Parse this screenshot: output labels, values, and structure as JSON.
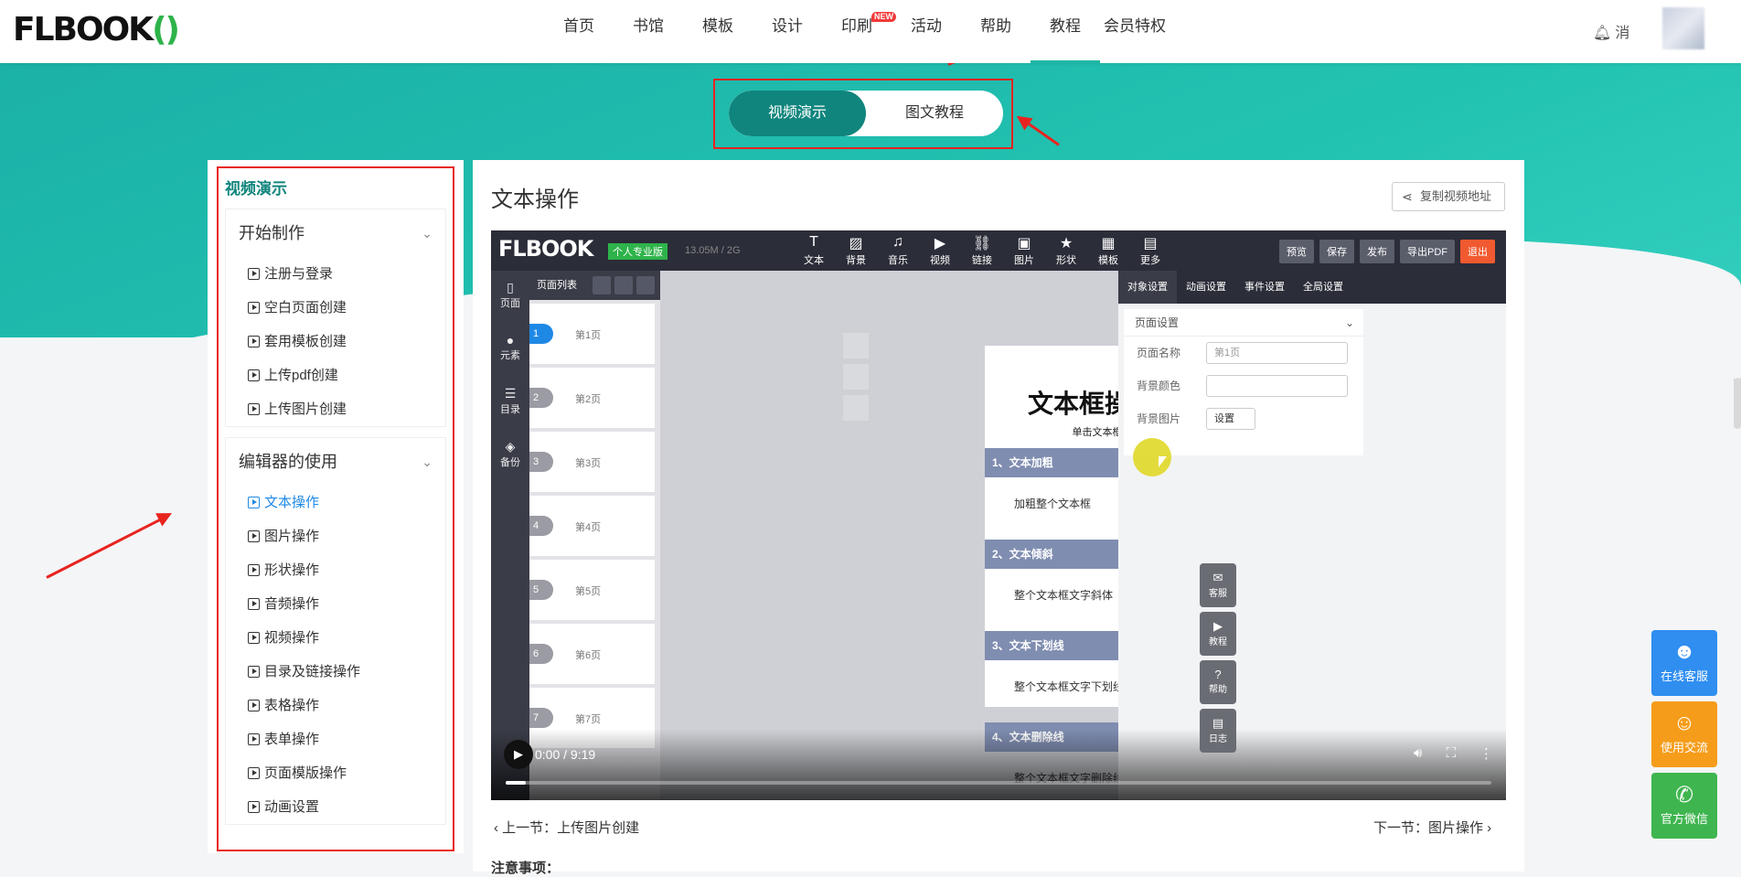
{
  "brand": {
    "logo_main": "FLBOOK",
    "logo_mark": "()"
  },
  "nav": {
    "items": [
      {
        "label": "首页"
      },
      {
        "label": "书馆"
      },
      {
        "label": "模板"
      },
      {
        "label": "设计"
      },
      {
        "label": "印刷",
        "tag": "NEW"
      },
      {
        "label": "活动"
      },
      {
        "label": "帮助"
      },
      {
        "label": "教程",
        "active": true
      },
      {
        "label": "会员特权"
      }
    ],
    "message_label": "消"
  },
  "toggle": {
    "options": [
      {
        "label": "视频演示",
        "selected": true
      },
      {
        "label": "图文教程"
      }
    ]
  },
  "sidebar": {
    "title": "视频演示",
    "groups": [
      {
        "title": "开始制作",
        "items": [
          "注册与登录",
          "空白页面创建",
          "套用模板创建",
          "上传pdf创建",
          "上传图片创建"
        ]
      },
      {
        "title": "编辑器的使用",
        "current": "文本操作",
        "items": [
          "文本操作",
          "图片操作",
          "形状操作",
          "音频操作",
          "视频操作",
          "目录及链接操作",
          "表格操作",
          "表单操作",
          "页面模版操作",
          "动画设置"
        ]
      }
    ]
  },
  "content": {
    "title": "文本操作",
    "copy_button": "复制视频地址",
    "prev": "上一节：上传图片创建",
    "next": "下一节：图片操作",
    "notes_heading": "注意事项："
  },
  "editor": {
    "logo": "FLBOOK",
    "plan_badge": "个人专业版",
    "storage": "13.05M / 2G",
    "tools": [
      {
        "icon": "T",
        "label": "文本"
      },
      {
        "icon": "▨",
        "label": "背景"
      },
      {
        "icon": "♫",
        "label": "音乐"
      },
      {
        "icon": "▶",
        "label": "视频"
      },
      {
        "icon": "⛓",
        "label": "链接"
      },
      {
        "icon": "▣",
        "label": "图片"
      },
      {
        "icon": "★",
        "label": "形状"
      },
      {
        "icon": "▦",
        "label": "模板"
      },
      {
        "icon": "▤",
        "label": "更多"
      }
    ],
    "buttons": [
      "预览",
      "保存",
      "发布",
      "导出PDF",
      "退出"
    ],
    "rail": [
      {
        "icon": "▯",
        "label": "页面"
      },
      {
        "icon": "●",
        "label": "元素"
      },
      {
        "icon": "☰",
        "label": "目录"
      },
      {
        "icon": "◈",
        "label": "备份"
      }
    ],
    "page_list_title": "页面列表",
    "pages": [
      "第1页",
      "第2页",
      "第3页",
      "第4页",
      "第5页",
      "第6页",
      "第7页"
    ],
    "card": {
      "title": "文本框操作演示",
      "subtitle": "单击文本框进行设置",
      "sections": [
        {
          "head": "1、文本加粗",
          "body": "加粗整个文本框"
        },
        {
          "head": "2、文本倾斜",
          "body": "整个文本框文字斜体"
        },
        {
          "head": "3、文本下划线",
          "body": "整个文本框文字下划线"
        },
        {
          "head": "4、文本删除线",
          "body": "整个文本框文字删除线"
        }
      ]
    },
    "right_buttons": [
      {
        "icon": "✉",
        "label": "客服"
      },
      {
        "icon": "▶",
        "label": "教程"
      },
      {
        "icon": "?",
        "label": "帮助"
      },
      {
        "icon": "▤",
        "label": "日志"
      }
    ],
    "panel_tabs": [
      "对象设置",
      "动画设置",
      "事件设置",
      "全局设置"
    ],
    "panel": {
      "section": "页面设置",
      "rows": [
        {
          "label": "页面名称",
          "value": "第1页"
        },
        {
          "label": "背景颜色",
          "value": ""
        },
        {
          "label": "背景图片",
          "value": "设置"
        }
      ]
    }
  },
  "video": {
    "time": "0:00 / 9:19",
    "progress": 0.02
  },
  "floating": [
    {
      "icon": "☻",
      "label": "在线客服",
      "color": "#2f8ef0"
    },
    {
      "icon": "☺",
      "label": "使用交流",
      "color": "#f59c1a"
    },
    {
      "icon": "✆",
      "label": "官方微信",
      "color": "#3fb54f"
    }
  ],
  "colors": {
    "accent": "#10857d",
    "highlight": "#e8231f",
    "link": "#1e88e5"
  }
}
